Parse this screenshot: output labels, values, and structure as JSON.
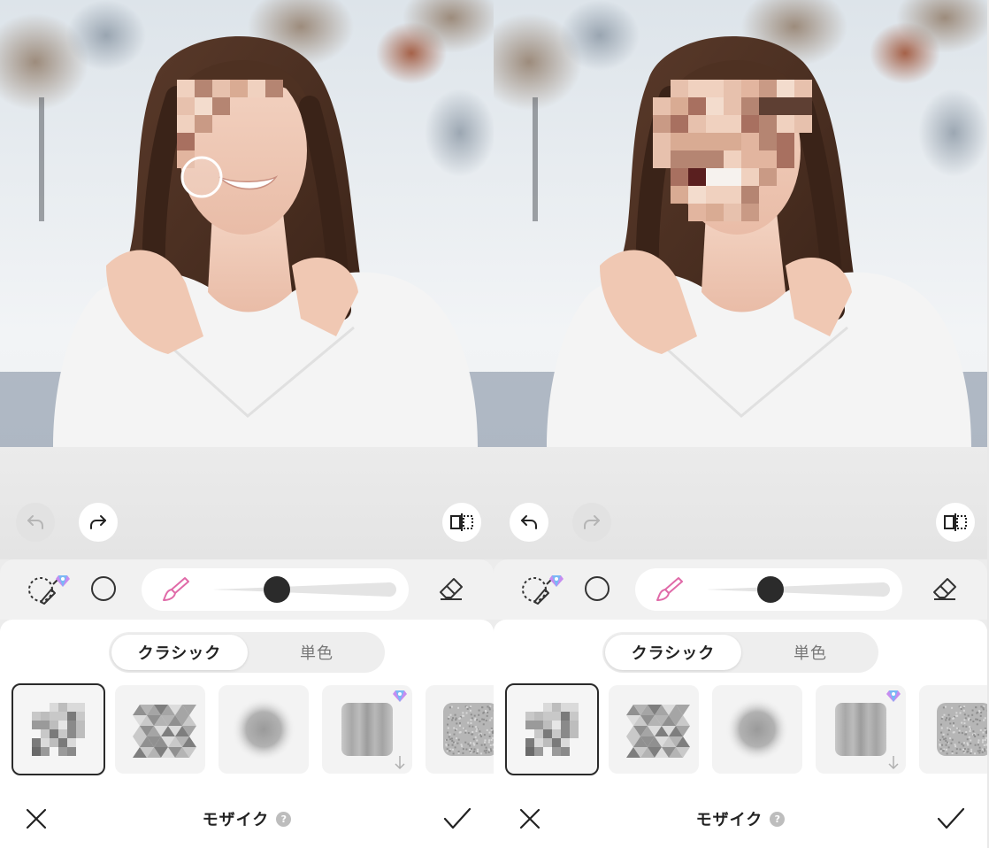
{
  "screens": [
    {
      "state": "before",
      "undo_enabled": false,
      "redo_enabled": true,
      "brush_size_fraction": 0.35,
      "mosaic_area": "small"
    },
    {
      "state": "after",
      "undo_enabled": true,
      "redo_enabled": false,
      "brush_size_fraction": 0.35,
      "mosaic_area": "full-face"
    }
  ],
  "segment": {
    "classic_label": "クラシック",
    "solid_label": "単色",
    "selected": "classic"
  },
  "tool_title": "モザイク",
  "help_label": "?",
  "patterns": [
    "pixel",
    "triangle",
    "blur",
    "stripe-blur",
    "noise"
  ],
  "icons": {
    "undo": "undo-icon",
    "redo": "redo-icon",
    "compare": "compare-icon",
    "lasso_brush": "lasso-brush-icon",
    "circle": "circle-shape-icon",
    "brush": "brush-icon",
    "eraser": "eraser-icon",
    "close": "close-icon",
    "confirm": "check-icon",
    "premium": "premium-gem-icon"
  },
  "colors": {
    "accent_pink": "#e06aa8",
    "text_dark": "#222222",
    "sheet_bg": "#ffffff"
  }
}
